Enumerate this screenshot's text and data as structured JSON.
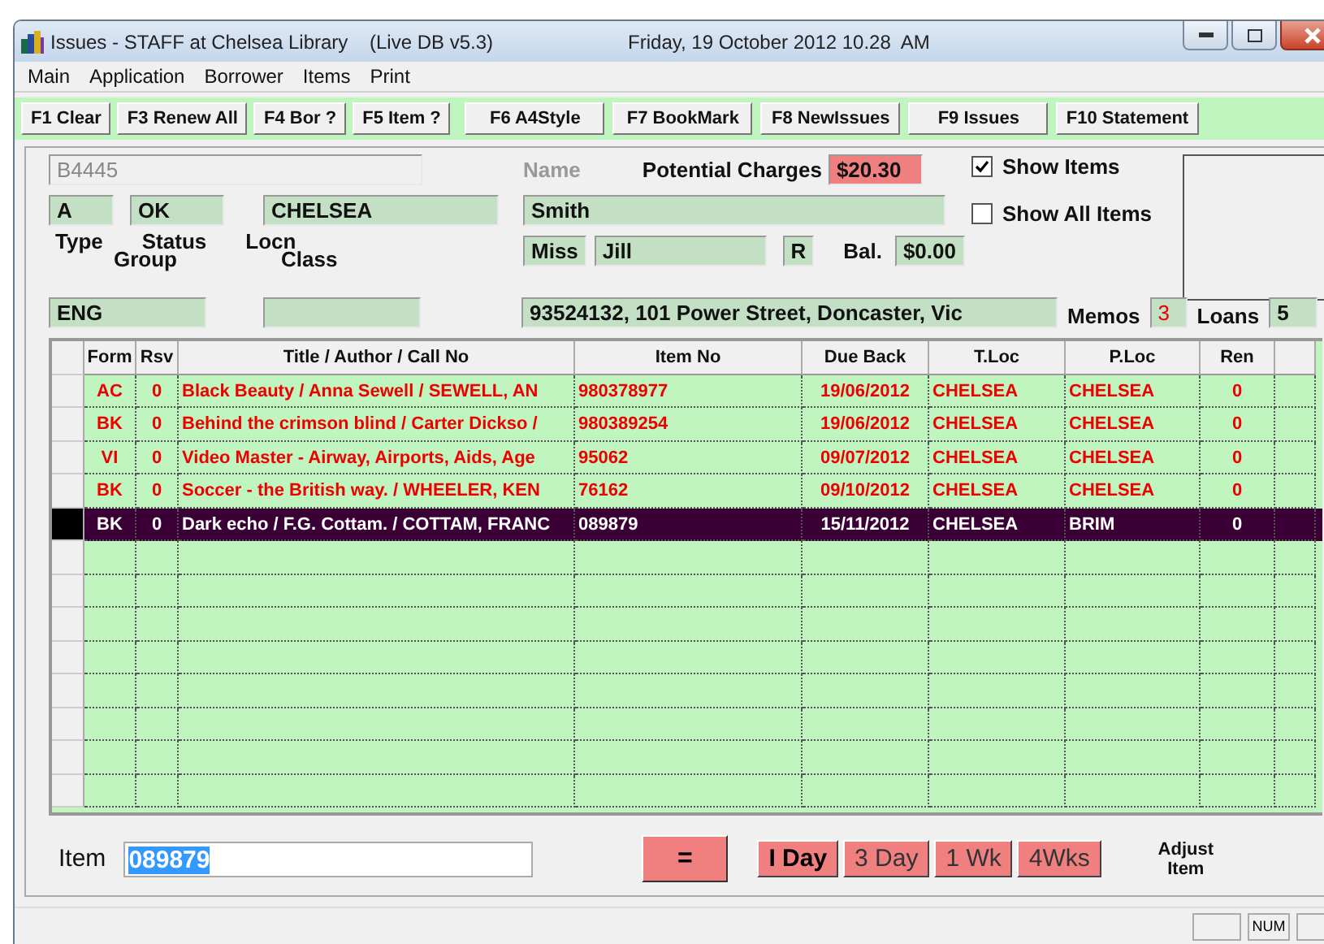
{
  "window": {
    "title": "Issues - STAFF at Chelsea Library    (Live DB v5.3)",
    "datetime": "Friday, 19 October 2012 10.28  AM"
  },
  "menu": [
    "Main",
    "Application",
    "Borrower",
    "Items",
    "Print"
  ],
  "toolbar": [
    "F1 Clear",
    "F3 Renew All",
    "F4 Bor ?",
    "F5 Item ?",
    "F6 A4Style",
    "F7 BookMark",
    "F8 NewIssues",
    "F9 Issues",
    "F10 Statement"
  ],
  "borrower": {
    "id": "B4445",
    "type": "A",
    "status": "OK",
    "locn": "CHELSEA",
    "labels": {
      "type": "Type",
      "status": "Status",
      "locn": "Locn",
      "group": "Group",
      "class": "Class",
      "name": "Name",
      "charges": "Potential Charges",
      "bal": "Bal.",
      "memos": "Memos",
      "loans": "Loans"
    },
    "group": "ENG",
    "surname": "Smith",
    "title": "Miss",
    "given": "Jill",
    "flag": "R",
    "charges": "$20.30",
    "balance": "$0.00",
    "address": "93524132, 101 Power Street, Doncaster, Vic",
    "memos": "3",
    "loans": "5"
  },
  "options": [
    {
      "label": "Show Items",
      "checked": true
    },
    {
      "label": "Show All Items",
      "checked": false
    }
  ],
  "table": {
    "columns": [
      "Form",
      "Rsv",
      "Title / Author / Call No",
      "Item No",
      "Due Back",
      "T.Loc",
      "P.Loc",
      "Ren"
    ],
    "rows": [
      {
        "selected": false,
        "cells": [
          "AC",
          "0",
          "Black Beauty / Anna Sewell / SEWELL, AN",
          "980378977",
          "19/06/2012",
          "CHELSEA",
          "CHELSEA",
          "0"
        ]
      },
      {
        "selected": false,
        "cells": [
          "BK",
          "0",
          "Behind the crimson blind / Carter Dickso /",
          "980389254",
          "19/06/2012",
          "CHELSEA",
          "CHELSEA",
          "0"
        ]
      },
      {
        "selected": false,
        "cells": [
          "VI",
          "0",
          "Video Master - Airway, Airports, Aids, Age",
          "95062",
          "09/07/2012",
          "CHELSEA",
          "CHELSEA",
          "0"
        ]
      },
      {
        "selected": false,
        "cells": [
          "BK",
          "0",
          "Soccer - the British way. / WHEELER, KEN",
          "76162",
          "09/10/2012",
          "CHELSEA",
          "CHELSEA",
          "0"
        ]
      },
      {
        "selected": true,
        "cells": [
          "BK",
          "0",
          "Dark echo / F.G. Cottam. / COTTAM, FRANC",
          "089879",
          "15/11/2012",
          "CHELSEA",
          "BRIM",
          "0"
        ]
      }
    ]
  },
  "item": {
    "label": "Item",
    "value": "089879"
  },
  "equals": "=",
  "durations": [
    {
      "label": "I Day",
      "selected": true
    },
    {
      "label": "3 Day",
      "selected": false
    },
    {
      "label": "1 Wk",
      "selected": false
    },
    {
      "label": "4Wks",
      "selected": false
    }
  ],
  "adjust": "Adjust Item",
  "status_bar": {
    "num": "NUM"
  }
}
